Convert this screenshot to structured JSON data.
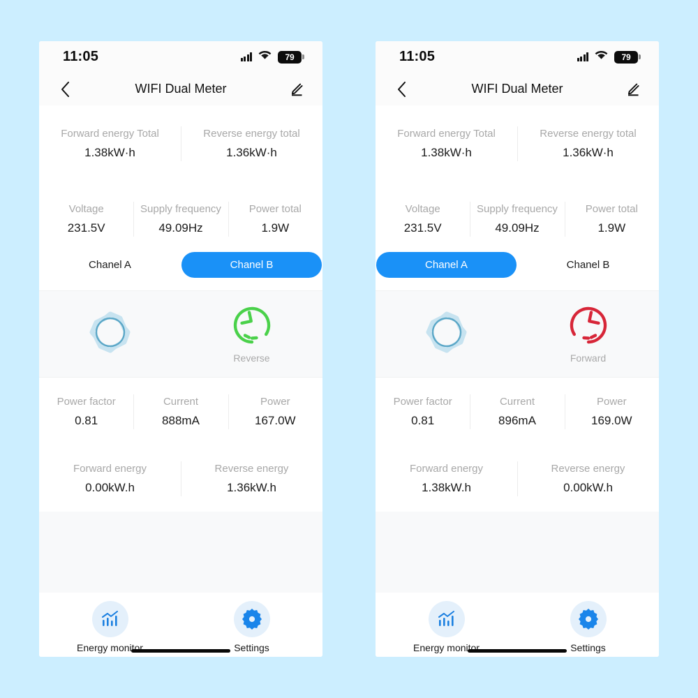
{
  "background_color": "#cceeff",
  "accent_color": "#1a91f7",
  "status": {
    "time": "11:05",
    "battery_level": "79",
    "signal_icon": "signal-bars-icon",
    "wifi_icon": "wifi-icon",
    "battery_icon": "battery-icon"
  },
  "nav": {
    "title": "WIFI Dual Meter",
    "back_icon": "chevron-left-icon",
    "edit_icon": "pencil-icon"
  },
  "totals": [
    {
      "label": "Forward energy Total",
      "value": "1.38kW·h"
    },
    {
      "label": "Reverse energy total",
      "value": "1.36kW·h"
    }
  ],
  "line_metrics": [
    {
      "label": "Voltage",
      "value": "231.5V"
    },
    {
      "label": "Supply frequency",
      "value": "49.09Hz"
    },
    {
      "label": "Power total",
      "value": "1.9W"
    }
  ],
  "channel_tabs": [
    {
      "label": "Chanel A"
    },
    {
      "label": "Chanel B"
    }
  ],
  "phones": [
    {
      "active_tab_index": 1,
      "dial": {
        "idle_icon": "idle-ring-icon",
        "direction_icon": "rotate-counterclockwise-icon",
        "direction_label": "Reverse",
        "direction_color": "#4ad14a"
      },
      "channel_metrics": [
        {
          "label": "Power factor",
          "value": "0.81"
        },
        {
          "label": "Current",
          "value": "888mA"
        },
        {
          "label": "Power",
          "value": "167.0W"
        }
      ],
      "channel_energy": [
        {
          "label": "Forward energy",
          "value": "0.00kW.h"
        },
        {
          "label": "Reverse energy",
          "value": "1.36kW.h"
        }
      ]
    },
    {
      "active_tab_index": 0,
      "dial": {
        "idle_icon": "idle-ring-icon",
        "direction_icon": "rotate-clockwise-icon",
        "direction_label": "Forward",
        "direction_color": "#d72638"
      },
      "channel_metrics": [
        {
          "label": "Power factor",
          "value": "0.81"
        },
        {
          "label": "Current",
          "value": "896mA"
        },
        {
          "label": "Power",
          "value": "169.0W"
        }
      ],
      "channel_energy": [
        {
          "label": "Forward energy",
          "value": "1.38kW.h"
        },
        {
          "label": "Reverse energy",
          "value": "0.00kW.h"
        }
      ]
    }
  ],
  "bottom_nav": [
    {
      "label": "Energy monitor",
      "icon": "bar-chart-trend-icon"
    },
    {
      "label": "Settings",
      "icon": "gear-icon"
    }
  ]
}
